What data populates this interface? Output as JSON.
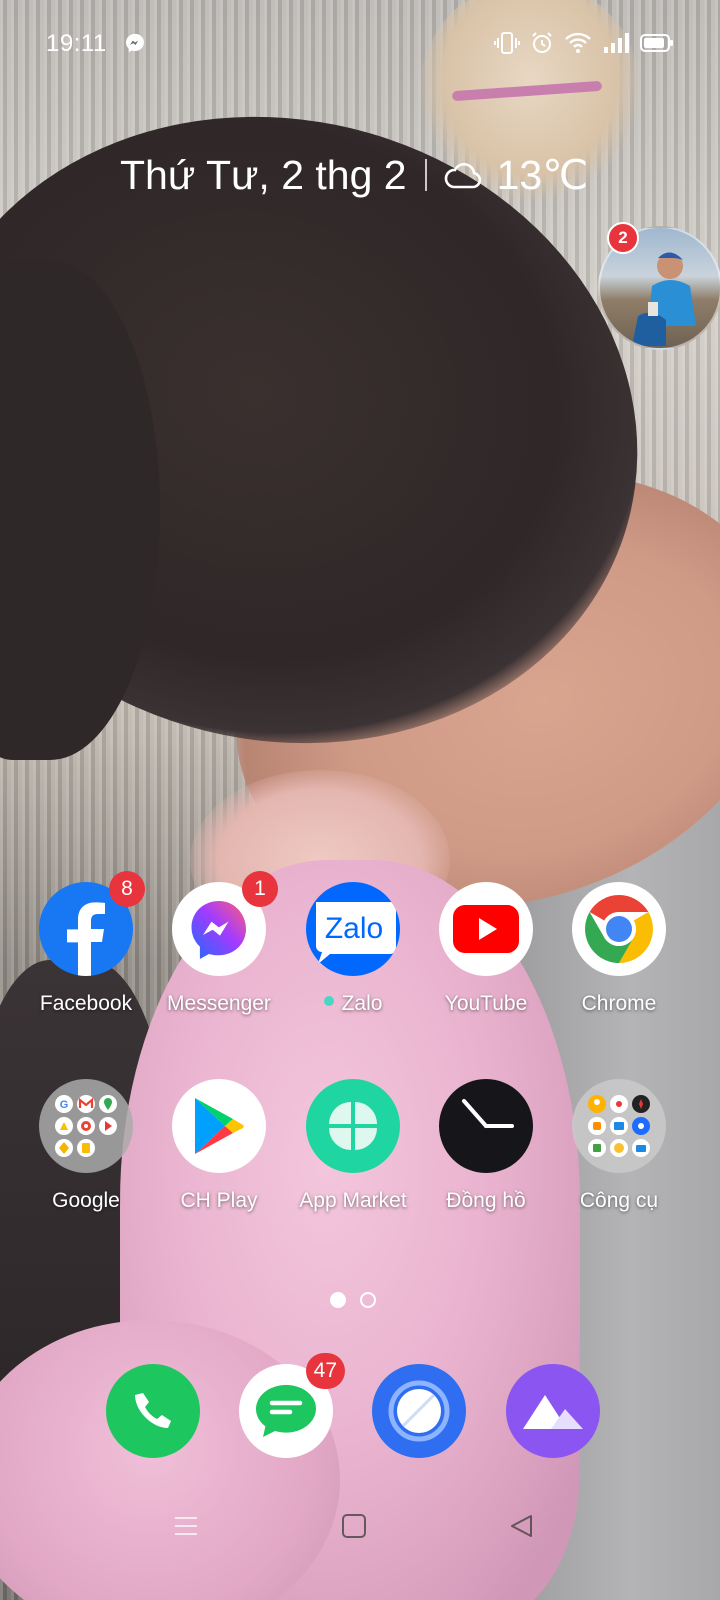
{
  "status_bar": {
    "time": "19:11",
    "notification_icons": [
      "messenger-icon"
    ],
    "system_icons": [
      "vibrate-icon",
      "alarm-icon",
      "wifi-icon",
      "signal-icon",
      "battery-icon"
    ]
  },
  "header": {
    "date": "Thứ Tư, 2 thg 2",
    "weather_icon": "cloud-icon",
    "temperature": "13℃"
  },
  "chat_bubble": {
    "badge": "2",
    "avatar": "contact-photo"
  },
  "apps": [
    {
      "label": "Facebook",
      "badge": "8",
      "icon": "facebook-icon",
      "color": "#1877f2"
    },
    {
      "label": "Messenger",
      "badge": "1",
      "icon": "messenger-icon",
      "color": "#a33bff"
    },
    {
      "label": "Zalo",
      "badge": "",
      "new_dot": true,
      "icon": "zalo-icon",
      "color": "#0068ff"
    },
    {
      "label": "YouTube",
      "badge": "",
      "icon": "youtube-icon",
      "color": "#ff0000"
    },
    {
      "label": "Chrome",
      "badge": "",
      "icon": "chrome-icon",
      "color": "#4285f4"
    },
    {
      "label": "Google",
      "badge": "",
      "icon": "google-folder-icon",
      "color": "#9a9a9a"
    },
    {
      "label": "CH Play",
      "badge": "",
      "icon": "play-store-icon",
      "color": "#01875f"
    },
    {
      "label": "App Market",
      "badge": "",
      "icon": "app-market-icon",
      "color": "#1fd6a2"
    },
    {
      "label": "Đồng hồ",
      "badge": "",
      "icon": "clock-icon",
      "color": "#16161a"
    },
    {
      "label": "Công cụ",
      "badge": "",
      "icon": "tools-folder-icon",
      "color": "#bfbfbf"
    }
  ],
  "page_indicator": {
    "current": 1,
    "total": 2
  },
  "dock": [
    {
      "name": "phone",
      "icon": "phone-icon",
      "badge": "",
      "color": "#1ec660"
    },
    {
      "name": "messages",
      "icon": "messages-icon",
      "badge": "47",
      "color": "#1ec660"
    },
    {
      "name": "browser",
      "icon": "browser-icon",
      "badge": "",
      "color": "#2f6ef0"
    },
    {
      "name": "gallery",
      "icon": "gallery-icon",
      "badge": "",
      "color": "#8a55f0"
    }
  ],
  "nav_bar": [
    "menu-icon",
    "home-icon",
    "back-icon"
  ]
}
